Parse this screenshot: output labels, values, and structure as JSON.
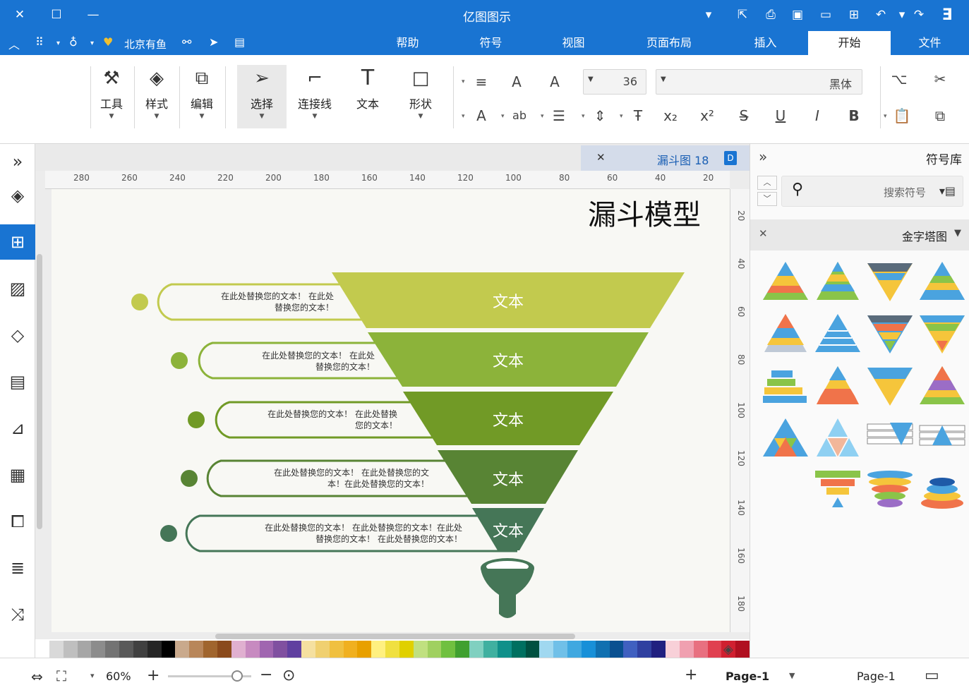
{
  "app": {
    "title": "亿图图示"
  },
  "menubar": {
    "brand_label": "北京有鱼",
    "tabs": [
      {
        "label": "文件"
      },
      {
        "label": "开始"
      },
      {
        "label": "插入"
      },
      {
        "label": "页面布局"
      },
      {
        "label": "视图"
      },
      {
        "label": "符号"
      },
      {
        "label": "帮助"
      }
    ]
  },
  "ribbon": {
    "font_name": "黑体",
    "font_size": "36",
    "buttons": {
      "shape": "形状",
      "text": "文本",
      "connector": "连接线",
      "select": "选择",
      "edit": "编辑",
      "style": "样式",
      "tools": "工具"
    }
  },
  "document": {
    "tab_label": "漏斗图 18"
  },
  "ruler": {
    "top_ticks": [
      "20",
      "40",
      "60",
      "80",
      "100",
      "120",
      "140",
      "160",
      "180",
      "200",
      "220",
      "240",
      "260",
      "280"
    ],
    "side_ticks": [
      "20",
      "40",
      "60",
      "80",
      "100",
      "120",
      "140",
      "160",
      "180"
    ]
  },
  "canvas": {
    "title": "漏斗模型",
    "funnel_levels": [
      {
        "label": "文本",
        "color": "#c2ca4e"
      },
      {
        "label": "文本",
        "color": "#8cb33a"
      },
      {
        "label": "文本",
        "color": "#719a26"
      },
      {
        "label": "文本",
        "color": "#588434"
      },
      {
        "label": "文本",
        "color": "#457657"
      }
    ],
    "callouts": [
      {
        "line1": "在此处替换您的文本！    在此处",
        "line2": "替换您的文本！"
      },
      {
        "line1": "在此处替换您的文本！    在此处",
        "line2": "替换您的文本！"
      },
      {
        "line1": "在此处替换您的文本！    在此处替换",
        "line2": "您的文本！"
      },
      {
        "line1": "在此处替换您的文本！    在此处替换您的文",
        "line2": "本！在此处替换您的文本！"
      },
      {
        "line1": "在此处替换您的文本！    在此处替换您的文本！在此处",
        "line2": "替换您的文本！    在此处替换您的文本！"
      }
    ]
  },
  "library": {
    "title": "符号库",
    "search_placeholder": "搜索符号",
    "category": "金字塔图"
  },
  "statusbar": {
    "page_tab": "Page-1",
    "page_current": "Page-1",
    "zoom": "60%"
  }
}
